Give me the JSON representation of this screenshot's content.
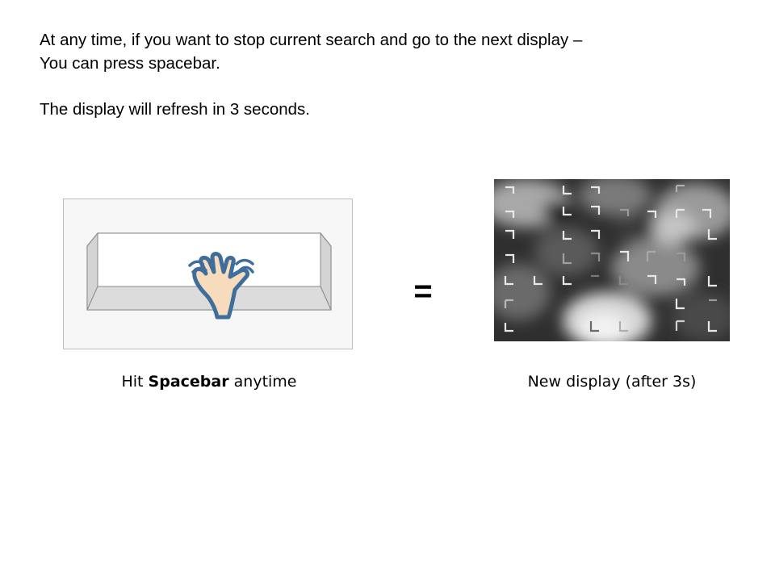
{
  "instructions": {
    "line1": "At any time, if you want to stop current search and go to the next display –",
    "line2": "You can press spacebar.",
    "line3": "The display will refresh in 3 seconds."
  },
  "illustration": {
    "left_icons": [
      "spacebar-key-icon",
      "hand-press-icon"
    ],
    "equals": "=",
    "right_image": "noise-search-display"
  },
  "captions": {
    "left_prefix": "Hit ",
    "left_bold": "Spacebar",
    "left_suffix": " anytime",
    "right": "New display (after 3s)"
  }
}
